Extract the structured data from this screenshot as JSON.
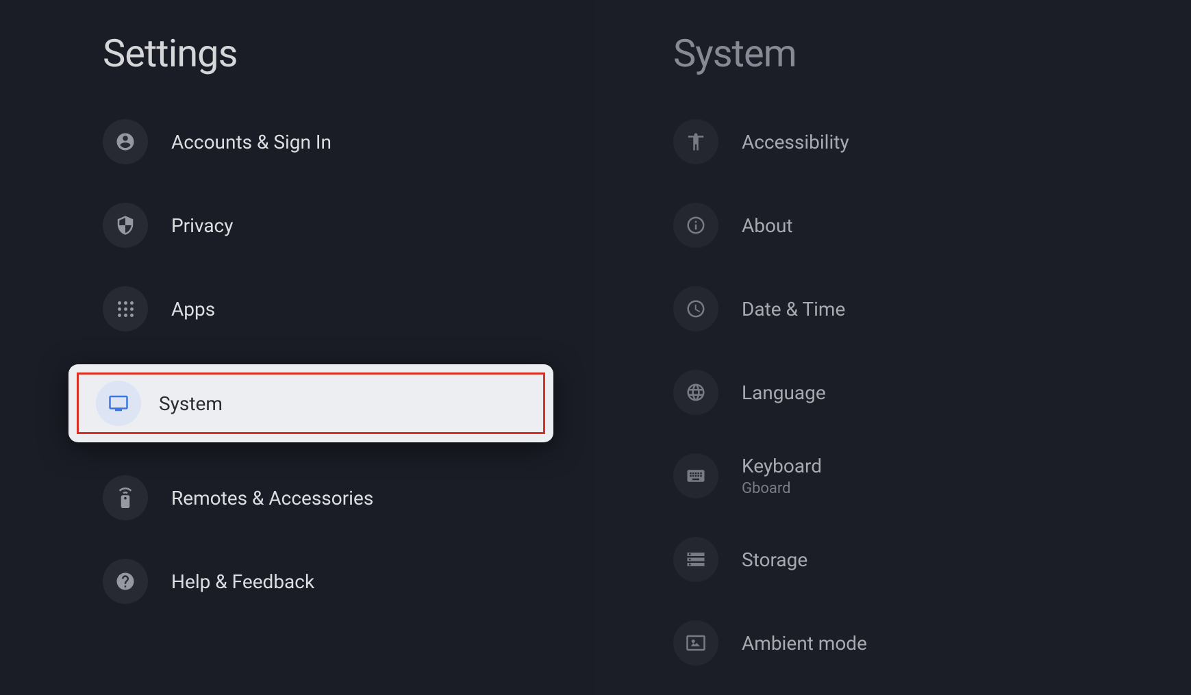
{
  "left": {
    "title": "Settings",
    "items": [
      {
        "label": "Accounts & Sign In",
        "icon": "account"
      },
      {
        "label": "Privacy",
        "icon": "shield"
      },
      {
        "label": "Apps",
        "icon": "apps"
      },
      {
        "label": "System",
        "icon": "tv",
        "selected": true
      },
      {
        "label": "Remotes & Accessories",
        "icon": "remote"
      },
      {
        "label": "Help & Feedback",
        "icon": "help"
      }
    ]
  },
  "right": {
    "title": "System",
    "items": [
      {
        "label": "Accessibility",
        "icon": "accessibility"
      },
      {
        "label": "About",
        "icon": "info"
      },
      {
        "label": "Date & Time",
        "icon": "clock"
      },
      {
        "label": "Language",
        "icon": "globe"
      },
      {
        "label": "Keyboard",
        "sublabel": "Gboard",
        "icon": "keyboard"
      },
      {
        "label": "Storage",
        "icon": "storage"
      },
      {
        "label": "Ambient mode",
        "icon": "ambient"
      }
    ]
  }
}
